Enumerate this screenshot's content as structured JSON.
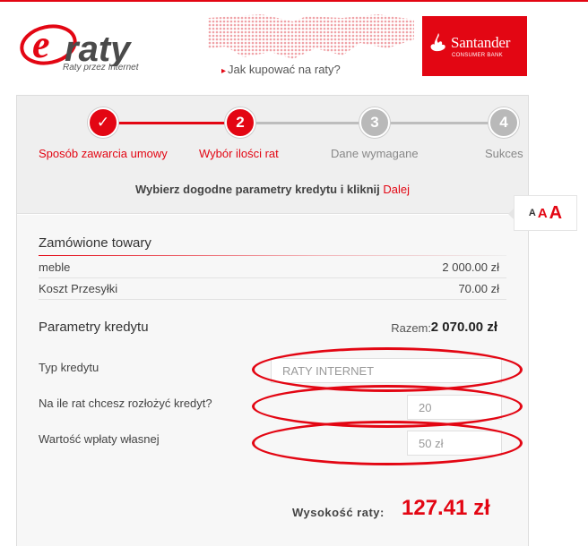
{
  "header": {
    "logo_text": "eraty",
    "logo_tagline": "Raty przez Internet",
    "how_to_link": "Jak kupować na raty?",
    "bank_name": "Santander",
    "bank_sub": "CONSUMER BANK"
  },
  "steps": [
    {
      "number": "✓",
      "label": "Sposób zawarcia umowy",
      "state": "done"
    },
    {
      "number": "2",
      "label": "Wybór ilości rat",
      "state": "active"
    },
    {
      "number": "3",
      "label": "Dane wymagane",
      "state": "todo"
    },
    {
      "number": "4",
      "label": "Sukces",
      "state": "todo"
    }
  ],
  "instruction": {
    "text": "Wybierz dogodne parametry kredytu i kliknij",
    "link": "Dalej"
  },
  "font_switch": {
    "small": "A",
    "medium": "A",
    "large": "A"
  },
  "ordered": {
    "title": "Zamówione towary",
    "items": [
      {
        "name": "meble",
        "value": "2 000.00 zł"
      },
      {
        "name": "Koszt Przesyłki",
        "value": "70.00 zł"
      }
    ]
  },
  "credit": {
    "title": "Parametry kredytu",
    "total_label": "Razem:",
    "total_value": "2 070.00 zł",
    "type_label": "Typ kredytu",
    "type_value": "RATY INTERNET",
    "installments_label": "Na ile rat chcesz rozłożyć kredyt?",
    "installments_value": "20",
    "down_payment_label": "Wartość wpłaty własnej",
    "down_payment_value": "50 zł"
  },
  "result": {
    "label": "Wysokość raty:",
    "value": "127.41 zł"
  },
  "colors": {
    "accent": "#e30613",
    "grey_step": "#b9b9b9"
  }
}
